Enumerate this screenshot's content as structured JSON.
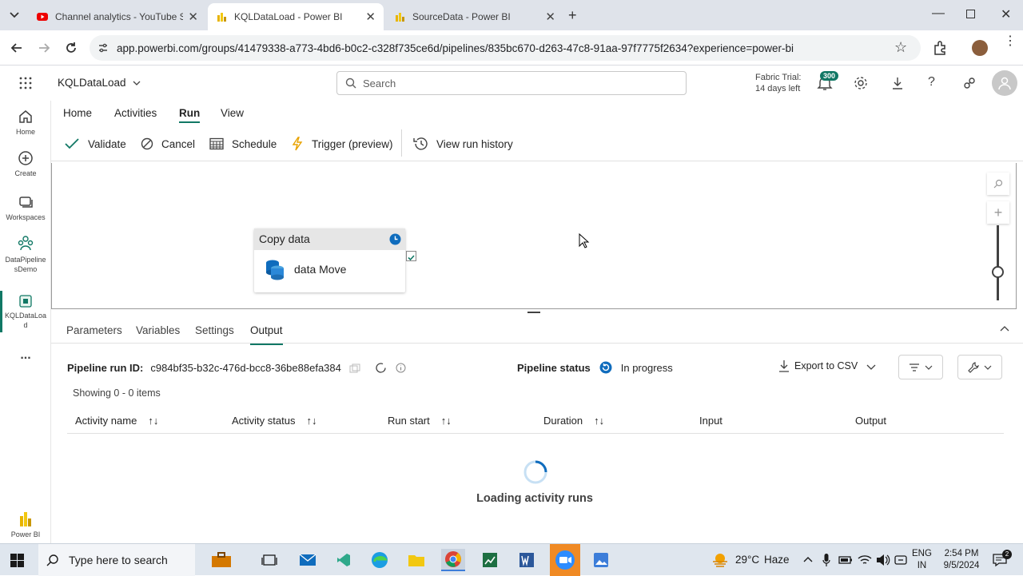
{
  "browser": {
    "tabs": [
      {
        "title": "Channel analytics - YouTube St",
        "icon": "youtube-icon"
      },
      {
        "title": "KQLDataLoad - Power BI",
        "icon": "powerbi-icon"
      },
      {
        "title": "SourceData - Power BI",
        "icon": "powerbi-icon"
      }
    ],
    "url": "app.powerbi.com/groups/41479338-a773-4bd6-b0c2-c328f735ce6d/pipelines/835bc670-d263-47c8-91aa-97f7775f2634?experience=power-bi"
  },
  "header": {
    "item_name": "KQLDataLoad",
    "search_placeholder": "Search",
    "trial_line1": "Fabric Trial:",
    "trial_line2": "14 days left",
    "notification_count": "300"
  },
  "rail": {
    "items": [
      {
        "label": "Home",
        "icon": "home-icon"
      },
      {
        "label": "Create",
        "icon": "create-icon"
      },
      {
        "label": "Workspaces",
        "icon": "workspaces-icon"
      },
      {
        "label": "DataPipeline sDemo",
        "icon": "workspace-icon"
      },
      {
        "label": "KQLDataLoa d",
        "icon": "pipeline-icon"
      }
    ],
    "more": "...",
    "bottom_label": "Power BI"
  },
  "ribbon": {
    "tabs": [
      "Home",
      "Activities",
      "Run",
      "View"
    ],
    "active_tab": "Run",
    "commands": [
      "Validate",
      "Cancel",
      "Schedule",
      "Trigger (preview)",
      "View run history"
    ]
  },
  "canvas": {
    "activity_type": "Copy data",
    "activity_name": "data Move"
  },
  "panel": {
    "tabs": [
      "Parameters",
      "Variables",
      "Settings",
      "Output"
    ],
    "active_tab": "Output",
    "run_id_label": "Pipeline run ID:",
    "run_id": "c984bf35-b32c-476d-bcc8-36be88efa384",
    "status_label": "Pipeline status",
    "status_value": "In progress",
    "export_label": "Export to CSV",
    "showing": "Showing 0 - 0 items",
    "columns": [
      "Activity name",
      "Activity status",
      "Run start",
      "Duration",
      "Input",
      "Output"
    ],
    "loading": "Loading activity runs"
  },
  "taskbar": {
    "search_placeholder": "Type here to search",
    "weather_temp": "29°C",
    "weather_text": "Haze",
    "lang1": "ENG",
    "lang2": "IN",
    "time": "2:54 PM",
    "date": "9/5/2024"
  },
  "colors": {
    "accent": "#117865",
    "status_blue": "#0f6cbd",
    "taskbar": "#dfe6ee"
  }
}
